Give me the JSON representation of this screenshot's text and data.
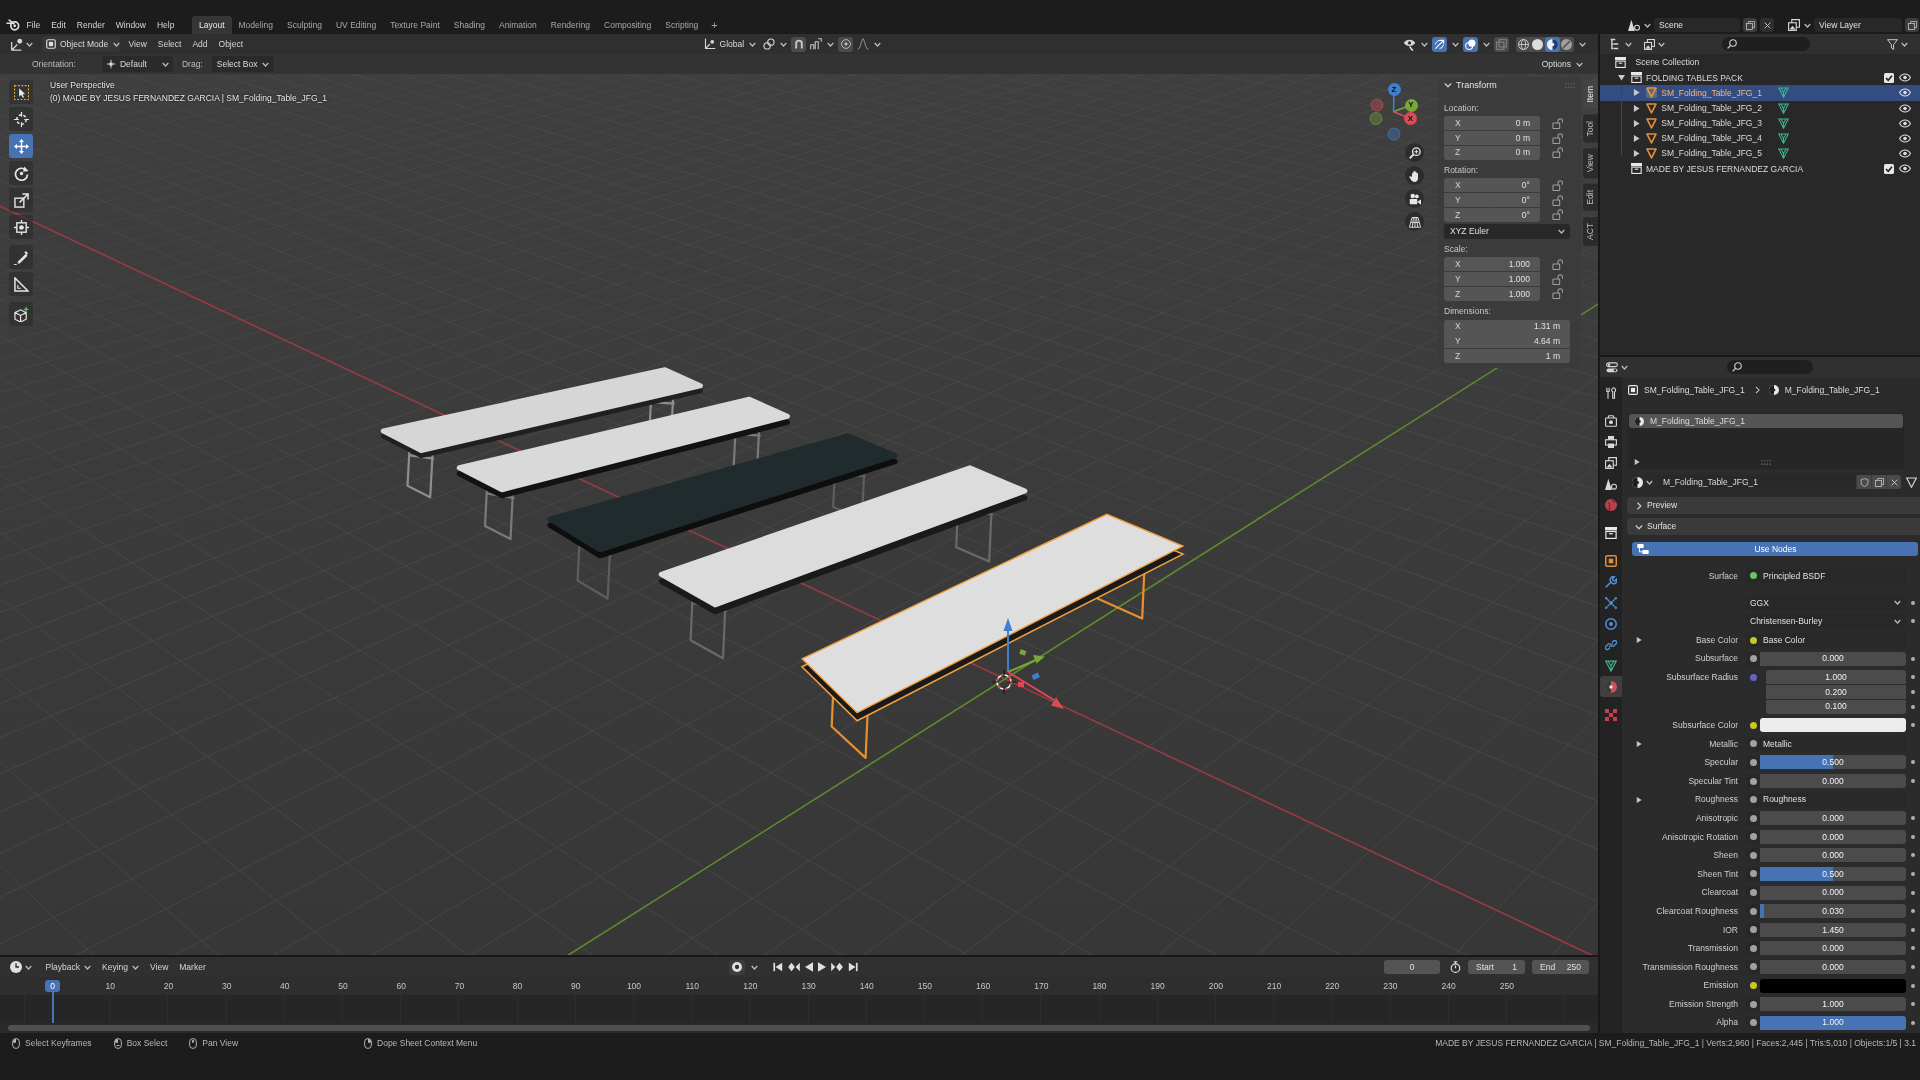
{
  "topbar": {
    "menus": [
      "File",
      "Edit",
      "Render",
      "Window",
      "Help"
    ],
    "workspaces": [
      {
        "label": "Layout",
        "selected": true
      },
      {
        "label": "Modeling",
        "selected": false
      },
      {
        "label": "Sculpting",
        "selected": false
      },
      {
        "label": "UV Editing",
        "selected": false
      },
      {
        "label": "Texture Paint",
        "selected": false
      },
      {
        "label": "Shading",
        "selected": false
      },
      {
        "label": "Animation",
        "selected": false
      },
      {
        "label": "Rendering",
        "selected": false
      },
      {
        "label": "Compositing",
        "selected": false
      },
      {
        "label": "Scripting",
        "selected": false
      }
    ],
    "add_workspace": "+",
    "scene": "Scene",
    "view_layer": "View Layer"
  },
  "viewport_header": {
    "mode": "Object Mode",
    "menus": [
      "View",
      "Select",
      "Add",
      "Object"
    ],
    "orientation": "Global",
    "snap": false,
    "proportional_editing": false,
    "show_gizmos": true,
    "show_overlays": true,
    "xray": false,
    "shading": [
      {
        "kind": "wireframe",
        "selected": false
      },
      {
        "kind": "solid",
        "selected": false
      },
      {
        "kind": "material",
        "selected": true
      },
      {
        "kind": "rendered",
        "selected": false
      }
    ]
  },
  "tool_settings": {
    "orientation_label": "Orientation:",
    "orientation": "Default",
    "drag_label": "Drag:",
    "drag": "Select Box",
    "options": "Options"
  },
  "toolbar": [
    [
      {
        "kind": "select",
        "selected": false
      },
      {
        "kind": "cursor",
        "selected": false
      },
      {
        "kind": "move",
        "selected": true
      },
      {
        "kind": "rotate",
        "selected": false
      },
      {
        "kind": "scale",
        "selected": false
      },
      {
        "kind": "transform",
        "selected": false
      }
    ],
    [
      {
        "kind": "annotate",
        "selected": false
      },
      {
        "kind": "measure",
        "selected": false
      }
    ],
    [
      {
        "kind": "add-cube",
        "selected": false
      }
    ]
  ],
  "viewport": {
    "view_name": "User Perspective",
    "object_info": "(0) MADE BY JESUS FERNANDEZ GARCIA | SM_Folding_Table_JFG_1",
    "gizmo_axes": [
      {
        "label": "X",
        "color": "#dc4a55"
      },
      {
        "label": "Y",
        "color": "#77a63b"
      },
      {
        "label": "Z",
        "color": "#3f7fd2"
      }
    ]
  },
  "sidebar": {
    "tabs": [
      {
        "label": "Item",
        "selected": true
      },
      {
        "label": "Tool",
        "selected": false
      },
      {
        "label": "View",
        "selected": false
      },
      {
        "label": "Edit",
        "selected": false
      },
      {
        "label": "ACT",
        "selected": false
      }
    ],
    "panel": {
      "title": "Transform",
      "expanded": true,
      "groups": [
        {
          "label": "Location:",
          "fields": [
            {
              "axis": "X",
              "value": "0 m",
              "locked": false
            },
            {
              "axis": "Y",
              "value": "0 m",
              "locked": false
            },
            {
              "axis": "Z",
              "value": "0 m",
              "locked": false
            }
          ]
        },
        {
          "label": "Rotation:",
          "fields": [
            {
              "axis": "X",
              "value": "0°",
              "locked": false
            },
            {
              "axis": "Y",
              "value": "0°",
              "locked": false
            },
            {
              "axis": "Z",
              "value": "0°",
              "locked": false
            }
          ],
          "mode": "XYZ Euler"
        },
        {
          "label": "Scale:",
          "fields": [
            {
              "axis": "X",
              "value": "1.000",
              "locked": false
            },
            {
              "axis": "Y",
              "value": "1.000",
              "locked": false
            },
            {
              "axis": "Z",
              "value": "1.000",
              "locked": false
            }
          ]
        },
        {
          "label": "Dimensions:",
          "fields": [
            {
              "axis": "X",
              "value": "1.31 m"
            },
            {
              "axis": "Y",
              "value": "4.64 m"
            },
            {
              "axis": "Z",
              "value": "1 m"
            }
          ]
        }
      ]
    }
  },
  "outliner": {
    "root": "Scene Collection",
    "items": [
      {
        "label": "FOLDING TABLES PACK",
        "kind": "collection",
        "expanded": true,
        "selected": false,
        "checked": true,
        "visible": true,
        "children": [
          {
            "label": "SM_Folding_Table_JFG_1",
            "kind": "object",
            "expanded": false,
            "selected": true,
            "visible": true
          },
          {
            "label": "SM_Folding_Table_JFG_2",
            "kind": "object",
            "expanded": false,
            "selected": false,
            "visible": true
          },
          {
            "label": "SM_Folding_Table_JFG_3",
            "kind": "object",
            "expanded": false,
            "selected": false,
            "visible": true
          },
          {
            "label": "SM_Folding_Table_JFG_4",
            "kind": "object",
            "expanded": false,
            "selected": false,
            "visible": true
          },
          {
            "label": "SM_Folding_Table_JFG_5",
            "kind": "object",
            "expanded": false,
            "selected": false,
            "visible": true
          }
        ]
      },
      {
        "label": "MADE BY JESUS FERNANDEZ GARCIA",
        "kind": "collection",
        "selected": false,
        "checked": true,
        "visible": true
      }
    ]
  },
  "properties": {
    "tabs": [
      [
        {
          "kind": "tool",
          "selected": false
        }
      ],
      [
        {
          "kind": "render",
          "selected": false
        },
        {
          "kind": "output",
          "selected": false
        },
        {
          "kind": "view-layer",
          "selected": false
        },
        {
          "kind": "scene",
          "selected": false
        },
        {
          "kind": "world",
          "selected": false
        }
      ],
      [
        {
          "kind": "collection",
          "selected": false
        }
      ],
      [
        {
          "kind": "object",
          "selected": false
        },
        {
          "kind": "modifiers",
          "selected": false
        },
        {
          "kind": "particles",
          "selected": false
        },
        {
          "kind": "physics",
          "selected": false
        },
        {
          "kind": "constraints",
          "selected": false
        },
        {
          "kind": "data",
          "selected": false
        },
        {
          "kind": "material",
          "selected": true
        }
      ],
      [
        {
          "kind": "texture",
          "selected": false
        }
      ]
    ],
    "breadcrumb": [
      {
        "kind": "object",
        "label": "SM_Folding_Table_JFG_1"
      },
      {
        "kind": "material",
        "label": "M_Folding_Table_JFG_1"
      }
    ],
    "slots": [
      {
        "label": "M_Folding_Table_JFG_1",
        "selected": true
      }
    ],
    "material": "M_Folding_Table_JFG_1",
    "panels": [
      {
        "title": "Preview",
        "expanded": false
      },
      {
        "title": "Surface",
        "expanded": true,
        "use_nodes": {
          "label": "Use Nodes",
          "on": true
        },
        "rows": [
          {
            "label": "Surface",
            "kind": "link",
            "color": "#63c763",
            "value": "Principled BSDF"
          },
          {
            "kind": "dropdown",
            "value": "GGX"
          },
          {
            "kind": "dropdown",
            "value": "Christensen-Burley"
          },
          {
            "label": "Base Color",
            "kind": "link",
            "color": "#c7c729",
            "value": "Base Color",
            "expanded": false
          },
          {
            "label": "Subsurface",
            "kind": "slider",
            "color": "#a1a1a1",
            "value": "0.000",
            "level": 0
          },
          {
            "label": "Subsurface Radius",
            "kind": "vector",
            "color": "#6363c7",
            "values": [
              "1.000",
              "0.200",
              "0.100"
            ]
          },
          {
            "label": "Subsurface Color",
            "kind": "color",
            "color": "#c7c729",
            "swatch": {
              "color": "#ececec"
            }
          },
          {
            "label": "Metallic",
            "kind": "link",
            "color": "#a1a1a1",
            "value": "Metallic",
            "expanded": false
          },
          {
            "label": "Specular",
            "kind": "slider",
            "color": "#a1a1a1",
            "value": "0.500",
            "level": 0.5
          },
          {
            "label": "Specular Tint",
            "kind": "slider",
            "color": "#a1a1a1",
            "value": "0.000",
            "level": 0
          },
          {
            "label": "Roughness",
            "kind": "link",
            "color": "#a1a1a1",
            "value": "Roughness",
            "expanded": false
          },
          {
            "label": "Anisotropic",
            "kind": "slider",
            "color": "#a1a1a1",
            "value": "0.000",
            "level": 0
          },
          {
            "label": "Anisotropic Rotation",
            "kind": "slider",
            "color": "#a1a1a1",
            "value": "0.000",
            "level": 0
          },
          {
            "label": "Sheen",
            "kind": "slider",
            "color": "#a1a1a1",
            "value": "0.000",
            "level": 0
          },
          {
            "label": "Sheen Tint",
            "kind": "slider",
            "color": "#a1a1a1",
            "value": "0.500",
            "level": 0.5
          },
          {
            "label": "Clearcoat",
            "kind": "slider",
            "color": "#a1a1a1",
            "value": "0.000",
            "level": 0
          },
          {
            "label": "Clearcoat Roughness",
            "kind": "slider",
            "color": "#a1a1a1",
            "value": "0.030",
            "level": 0.03
          },
          {
            "label": "IOR",
            "kind": "number",
            "color": "#a1a1a1",
            "value": "1.450"
          },
          {
            "label": "Transmission",
            "kind": "slider",
            "color": "#a1a1a1",
            "value": "0.000",
            "level": 0
          },
          {
            "label": "Transmission Roughness",
            "kind": "slider",
            "color": "#a1a1a1",
            "value": "0.000",
            "level": 0
          },
          {
            "label": "Emission",
            "kind": "color",
            "color": "#c7c729",
            "swatch": {
              "color": "#000000"
            }
          },
          {
            "label": "Emission Strength",
            "kind": "number",
            "color": "#a1a1a1",
            "value": "1.000"
          },
          {
            "label": "Alpha",
            "kind": "slider",
            "color": "#a1a1a1",
            "value": "1.000",
            "level": 1
          }
        ]
      }
    ]
  },
  "timeline": {
    "menus": [
      {
        "label": "Playback",
        "kind": "dropdown"
      },
      {
        "label": "Keying",
        "kind": "dropdown"
      },
      {
        "label": "View",
        "kind": "menu"
      },
      {
        "label": "Marker",
        "kind": "menu"
      }
    ],
    "auto_keying": false,
    "current_frame": "0",
    "start_label": "Start",
    "start": "1",
    "end_label": "End",
    "end": "250",
    "playhead": "0",
    "ruler": [
      "10",
      "20",
      "30",
      "40",
      "50",
      "60",
      "70",
      "80",
      "90",
      "100",
      "110",
      "120",
      "130",
      "140",
      "150",
      "160",
      "170",
      "180",
      "190",
      "200",
      "210",
      "220",
      "230",
      "240",
      "250"
    ]
  },
  "status_bar": {
    "hints": [
      {
        "kind": "mouse-left",
        "label": "Select Keyframes"
      },
      {
        "kind": "mouse-drag",
        "label": "Box Select"
      },
      {
        "kind": "mouse-middle",
        "label": "Pan View"
      },
      {
        "kind": "mouse-right",
        "label": "Dope Sheet Context Menu"
      }
    ],
    "stats": "MADE BY JESUS FERNANDEZ GARCIA | SM_Folding_Table_JFG_1 | Verts:2,960 | Faces:2,445 | Tris:5,010 | Objects:1/5 | 3.1"
  }
}
